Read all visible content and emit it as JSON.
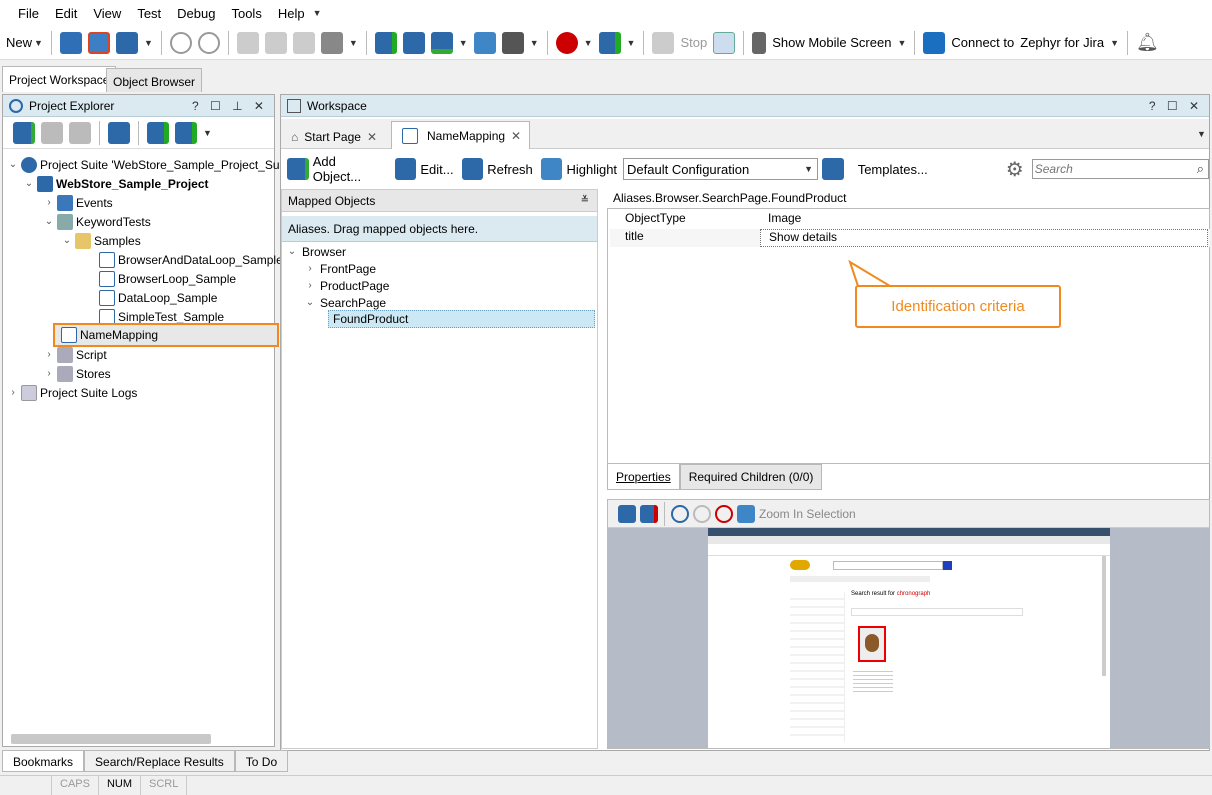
{
  "menu": [
    "File",
    "Edit",
    "View",
    "Test",
    "Debug",
    "Tools",
    "Help"
  ],
  "toolbar": {
    "new": "New",
    "stop": "Stop",
    "mobile": "Show Mobile Screen",
    "connect": "Connect to",
    "zephyr": "Zephyr for Jira"
  },
  "ws_tabs": [
    "Project Workspace",
    "Object Browser"
  ],
  "explorer": {
    "title": "Project Explorer",
    "items": [
      "Project Suite 'WebStore_Sample_Project_Suite' (",
      "WebStore_Sample_Project",
      "Events",
      "KeywordTests",
      "Samples",
      "BrowserAndDataLoop_Sample",
      "BrowserLoop_Sample",
      "DataLoop_Sample",
      "SimpleTest_Sample",
      "NameMapping",
      "Script",
      "Stores",
      "Project Suite Logs"
    ]
  },
  "workspace": {
    "title": "Workspace",
    "tabs": [
      "Start Page",
      "NameMapping"
    ]
  },
  "nm_toolbar": {
    "add": "Add Object...",
    "edit": "Edit...",
    "refresh": "Refresh",
    "highlight": "Highlight",
    "config": "Default Configuration",
    "templates": "Templates...",
    "search_placeholder": "Search"
  },
  "mapped": {
    "title": "Mapped Objects",
    "aliases": "Aliases. Drag mapped objects here.",
    "tree": [
      "Browser",
      "FrontPage",
      "ProductPage",
      "SearchPage",
      "FoundProduct"
    ]
  },
  "props": {
    "path": "Aliases.Browser.SearchPage.FoundProduct",
    "rows": [
      {
        "k": "ObjectType",
        "v": "Image"
      },
      {
        "k": "title",
        "v": "Show details"
      }
    ],
    "callout": "Identification criteria",
    "tabs": [
      "Properties",
      "Required Children (0/0)"
    ]
  },
  "preview": {
    "zoom": "Zoom In Selection",
    "search_result": "Search result for",
    "query": "chronograph"
  },
  "bottom_tabs": [
    "Bookmarks",
    "Search/Replace Results",
    "To Do"
  ],
  "status": [
    "CAPS",
    "NUM",
    "SCRL"
  ]
}
